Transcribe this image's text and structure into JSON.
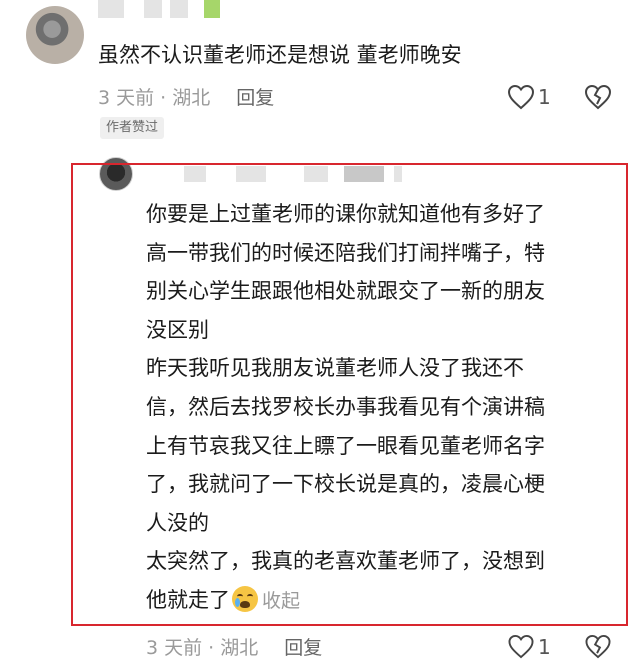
{
  "comment": {
    "text": "虽然不认识董老师还是想说 董老师晚安",
    "time_location": "3 天前 · 湖北",
    "reply_label": "回复",
    "like_count": "1",
    "badge": "作者赞过"
  },
  "reply": {
    "lines": [
      "你要是上过董老师的课你就知道他有多好了",
      "高一带我们的时候还陪我们打闹拌嘴子，特",
      "别关心学生跟跟他相处就跟交了一新的朋友",
      "没区别",
      "昨天我听见我朋友说董老师人没了我还不",
      "信，然后去找罗校长办事我看见有个演讲稿",
      "上有节哀我又往上瞟了一眼看见董老师名字",
      "了，我就问了一下校长说是真的，凌晨心梗",
      "人没的",
      "太突然了，我真的老喜欢董老师了，没想到",
      "他就走了"
    ],
    "collapse_label": "收起",
    "time_location": "3 天前 · 湖北",
    "reply_label": "回复",
    "like_count": "1"
  },
  "colors": {
    "highlight_border": "#d8262e",
    "meta_gray": "#9a9a9a"
  }
}
